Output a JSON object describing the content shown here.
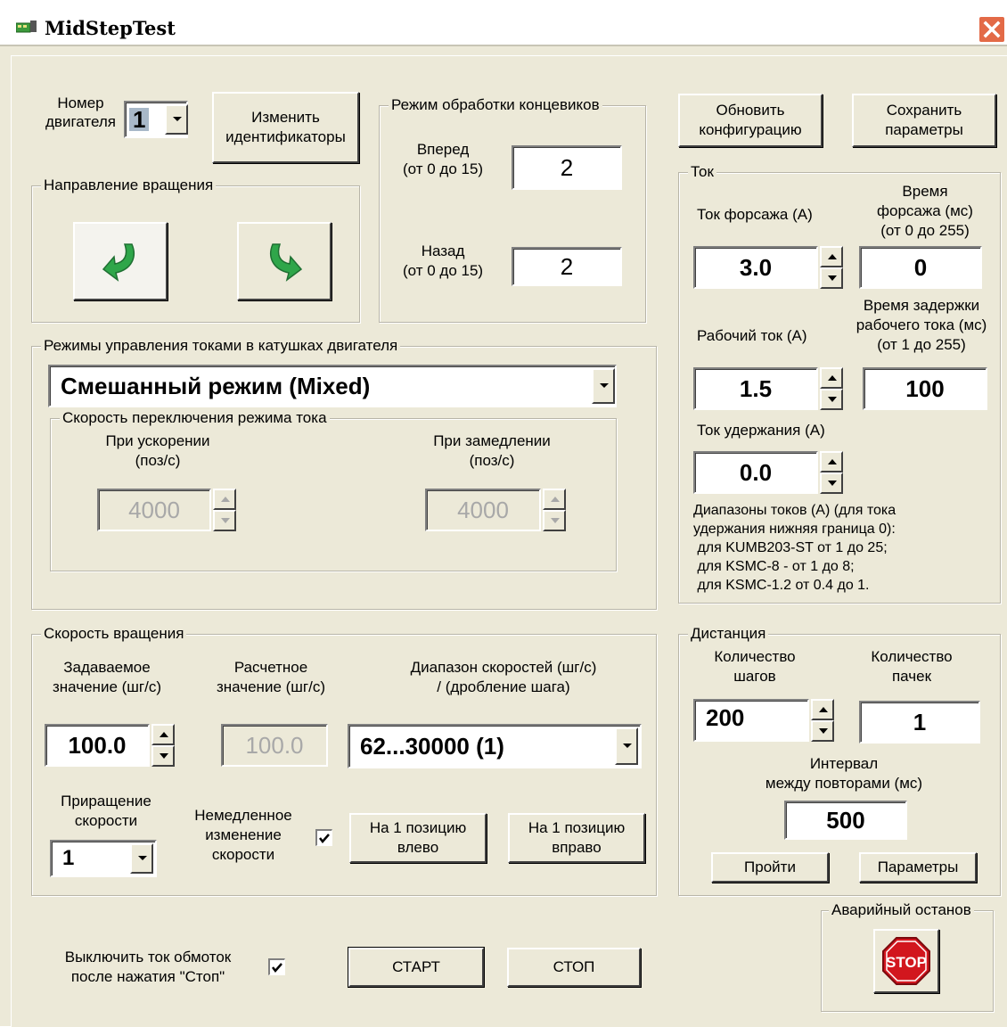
{
  "window": {
    "title": "MidStepTest"
  },
  "motor": {
    "number_label": "Номер\nдвигателя",
    "number_value": "1",
    "change_ids_label": "Изменить\nидентификаторы"
  },
  "direction": {
    "legend": "Направление вращения",
    "cw_icon": "green-curved-arrow-cw-icon",
    "ccw_icon": "green-curved-arrow-ccw-icon"
  },
  "limit_switches": {
    "legend": "Режим обработки концевиков",
    "forward_label": "Вперед\n(от 0 до 15)",
    "forward_value": "2",
    "back_label": "Назад\n(от 0 до 15)",
    "back_value": "2"
  },
  "top_buttons": {
    "refresh": "Обновить\nконфигурацию",
    "save": "Сохранить\nпараметры"
  },
  "current_modes": {
    "legend": "Режимы управления токами в катушках двигателя",
    "selected": "Смешанный режим (Mixed)",
    "switch_speed": {
      "legend": "Скорость переключения режима тока",
      "accel_label": "При ускорении\n(поз/с)",
      "accel_value": "4000",
      "decel_label": "При замедлении\n(поз/с)",
      "decel_value": "4000"
    }
  },
  "current": {
    "legend": "Ток",
    "boost_label": "Ток форсажа (А)",
    "boost_value": "3.0",
    "boost_time_label": "Время\nфорсажа (мс)\n(от 0 до 255)",
    "boost_time_value": "0",
    "work_label": "Рабочий ток (А)",
    "work_value": "1.5",
    "work_delay_label": "Время задержки\nрабочего тока (мс)\n(от 1 до 255)",
    "work_delay_value": "100",
    "hold_label": "Ток удержания (А)",
    "hold_value": "0.0",
    "ranges_note": "Диапазоны токов (А) (для тока\nудержания нижняя граница 0):\n для KUMB203-ST от 1 до 25;\n для KSMC-8 - от 1 до 8;\n для KSMC-1.2 от 0.4 до 1."
  },
  "speed": {
    "legend": "Скорость вращения",
    "set_label": "Задаваемое\nзначение (шг/с)",
    "set_value": "100.0",
    "calc_label": "Расчетное\nзначение (шг/с)",
    "calc_value": "100.0",
    "range_label": "Диапазон скоростей (шг/с)\n/ (дробление шага)",
    "range_value": "62...30000  (1)",
    "increment_label": "Приращение\nскорости",
    "increment_value": "1",
    "immediate_label": "Немедленное\nизменение\nскорости",
    "immediate_checked": true,
    "step_left": "На 1 позицию\nвлево",
    "step_right": "На 1 позицию\nвправо"
  },
  "distance": {
    "legend": "Дистанция",
    "steps_label": "Количество\nшагов",
    "steps_value": "200",
    "packs_label": "Количество\nпачек",
    "packs_value": "1",
    "interval_label": "Интервал\nмежду повторами (мс)",
    "interval_value": "500",
    "go_button": "Пройти",
    "params_button": "Параметры"
  },
  "emergency": {
    "legend": "Аварийный останов",
    "stop_sign_text": "STOP",
    "stop_icon": "stop-sign-icon"
  },
  "bottom": {
    "off_current_label": "Выключить ток обмоток\nпосле нажатия \"Стоп\"",
    "off_current_checked": true,
    "start": "СТАРТ",
    "stop": "СТОП"
  },
  "colors": {
    "face": "#ece9d8",
    "close": "#e36a47",
    "arrow_green": "#2fa64a",
    "stop_red": "#d2161e"
  }
}
